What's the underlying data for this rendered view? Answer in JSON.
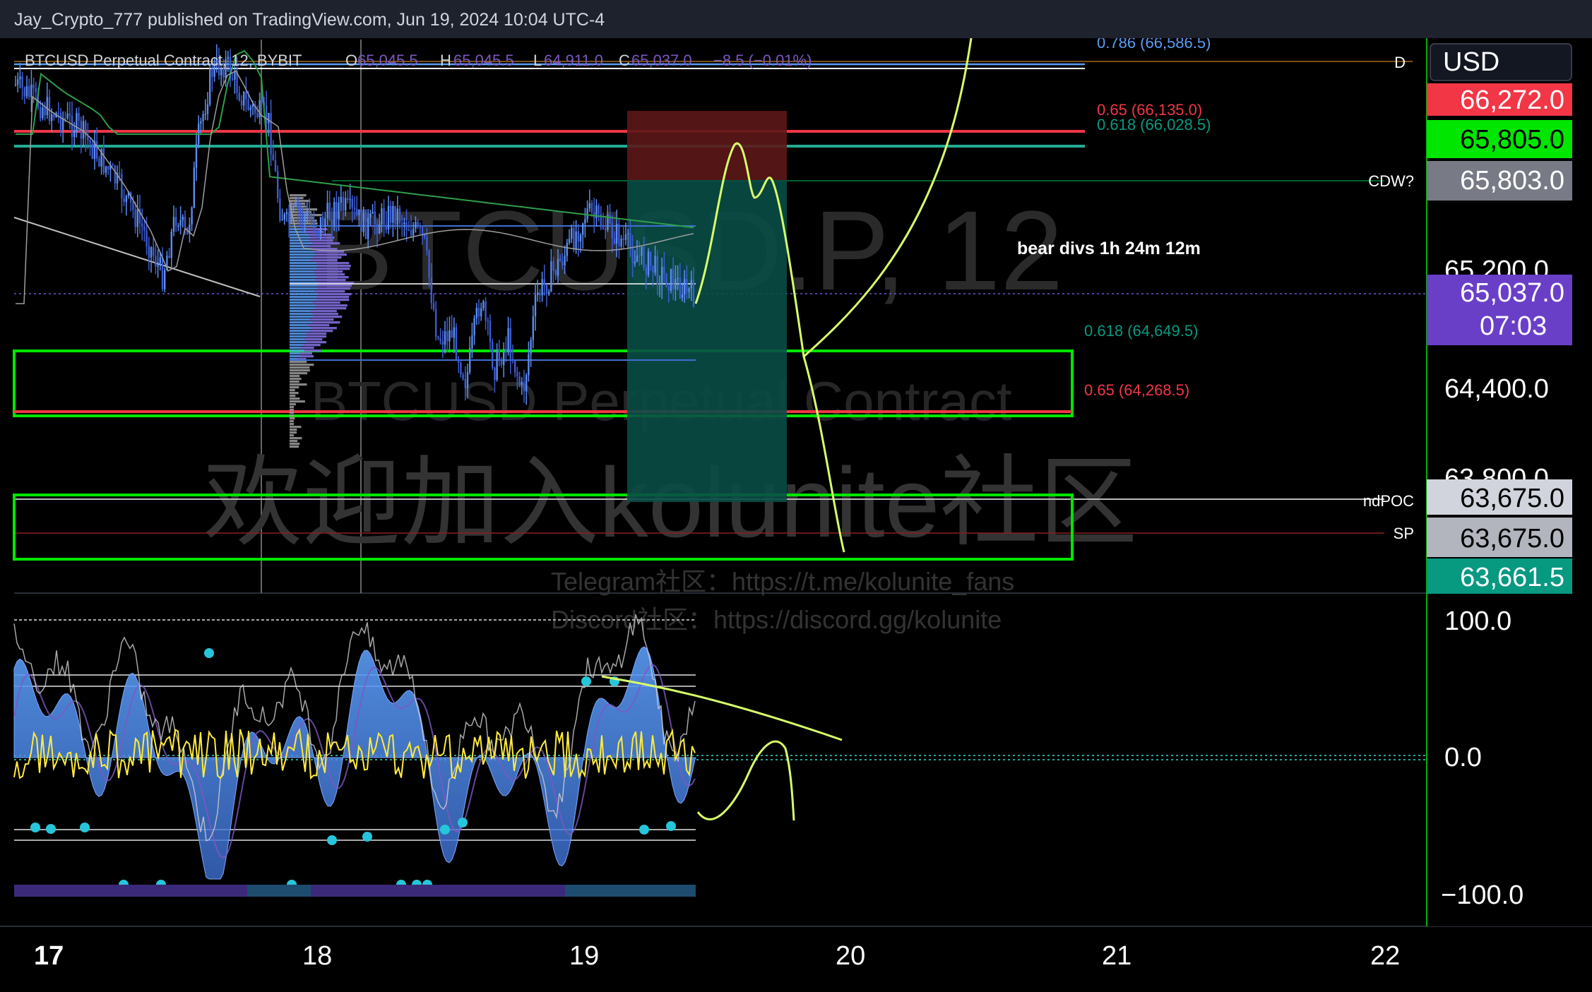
{
  "header": {
    "published": "Jay_Crypto_777 published on TradingView.com, Jun 19, 2024 10:04 UTC-4"
  },
  "legend": {
    "symbol": "BTCUSD Perpetual Contract, 12, BYBIT",
    "o_label": "O",
    "o_value": "65,045.5",
    "h_label": "H",
    "h_value": "65,045.5",
    "l_label": "L",
    "l_value": "64,911.0",
    "c_label": "C",
    "c_value": "65,037.0",
    "change": "−8.5 (−0.01%)"
  },
  "watermark": {
    "ticker": "BTCUSD.P, 12",
    "name": "BTCUSD Perpetual Contract",
    "cn": "欢迎加入kolunite社区",
    "telegram": "Telegram社区：https://t.me/kolunite_fans",
    "discord": "Discord社区：https://discord.gg/kolunite"
  },
  "note": "bear divs 1h 24m 12m",
  "chart_data": [
    {
      "type": "candlestick",
      "title": "BTCUSD Perpetual Contract, 12, BYBIT",
      "x_ticks": [
        "17",
        "18",
        "19",
        "20",
        "21",
        "22"
      ],
      "y_ticks": [
        "64,400.0",
        "65,200.0",
        "63,800.0"
      ],
      "ylim": [
        63450,
        66660
      ],
      "last": {
        "open": 65045.5,
        "high": 65045.5,
        "low": 64911.0,
        "close": 65037.0,
        "change": -8.5,
        "change_pct": -0.01
      },
      "price_tags": [
        {
          "label": "USD",
          "value": "",
          "color": "#131722"
        },
        {
          "label": "",
          "value": "66,272.0",
          "color": "#f23645"
        },
        {
          "label": "",
          "value": "65,805.0",
          "color": "#00e600"
        },
        {
          "label": "",
          "value": "65,803.0",
          "color": "#787b86"
        },
        {
          "label": "",
          "value": "65,037.0",
          "sub": "07:03",
          "color": "#6a3fc8"
        },
        {
          "label": "",
          "value": "63,675.0",
          "color": "#d1d4dc"
        },
        {
          "label": "",
          "value": "63,675.0",
          "color": "#d1d4dc"
        },
        {
          "label": "",
          "value": "63,661.5",
          "color": "#089981"
        }
      ],
      "fib_levels": [
        {
          "ratio": "0.786",
          "value": "66,586.5",
          "color": "#5b9cf6"
        },
        {
          "ratio": "0.65",
          "value": "66,135.0",
          "color": "#f23645"
        },
        {
          "ratio": "0.618",
          "value": "66,028.5",
          "color": "#089981"
        },
        {
          "ratio": "0.618",
          "value": "64,649.5",
          "color": "#089981"
        },
        {
          "ratio": "0.65",
          "value": "64,268.5",
          "color": "#f23645"
        }
      ],
      "line_labels": [
        "D",
        "CDW?",
        "ndPOC",
        "SP"
      ]
    },
    {
      "type": "line",
      "title": "",
      "y_ticks": [
        "100.0",
        "0.0",
        "−100.0"
      ],
      "ylim": [
        -110,
        110
      ]
    }
  ]
}
